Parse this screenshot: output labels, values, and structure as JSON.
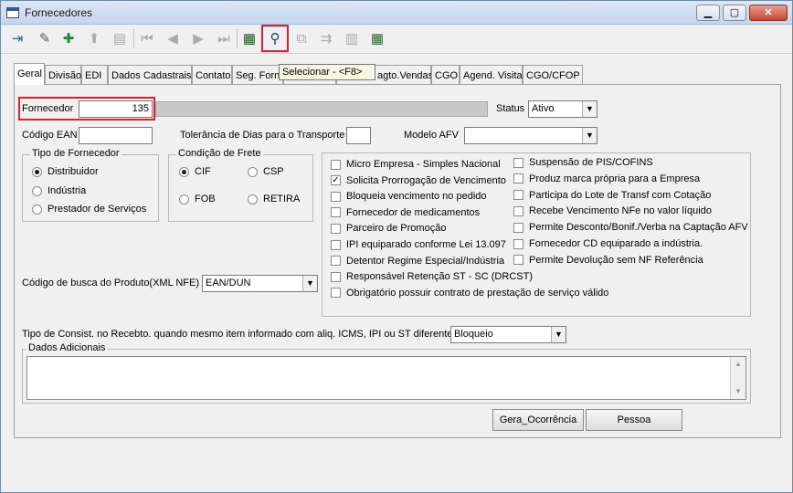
{
  "window": {
    "title": "Fornecedores"
  },
  "tooltip": "Selecionar - <F8>",
  "tabs": [
    "Geral",
    "Divisão",
    "EDI",
    "Dados Cadastrais",
    "Contato",
    "Seg. Forn",
    "",
    "agto.Vendas",
    "CGO",
    "Agend. Visita",
    "CGO/CFOP"
  ],
  "form": {
    "fornecedor_label": "Fornecedor",
    "fornecedor_value": "135",
    "status_label": "Status",
    "status_value": "Ativo",
    "codigo_ean_label": "Código EAN",
    "tolerancia_label": "Tolerância de Dias para o Transporte",
    "modelo_afv_label": "Modelo AFV",
    "tipo_fornecedor_label": "Tipo de Fornecedor",
    "tipo_options": [
      "Distribuidor",
      "Indústria",
      "Prestador de Serviços"
    ],
    "condicao_frete_label": "Condição de Frete",
    "frete_options": [
      "CIF",
      "CSP",
      "FOB",
      "RETIRA"
    ],
    "codigo_busca_label": "Código de busca do Produto(XML NFE) :",
    "codigo_busca_value": "EAN/DUN",
    "tipo_consist_label": "Tipo de Consist. no Recebto. quando mesmo item informado com aliq. ICMS, IPI ou ST diferentes:",
    "tipo_consist_value": "Bloqueio",
    "dados_adicionais_label": "Dados Adicionais"
  },
  "checks_left": [
    {
      "label": "Micro Empresa - Simples Nacional",
      "checked": false
    },
    {
      "label": "Solicita Prorrogação de Vencimento",
      "checked": true
    },
    {
      "label": "Bloqueia vencimento no pedido",
      "checked": false
    },
    {
      "label": "Fornecedor de medicamentos",
      "checked": false
    },
    {
      "label": "Parceiro de Promoção",
      "checked": false
    },
    {
      "label": "IPI equiparado conforme Lei 13.097",
      "checked": false
    },
    {
      "label": "Detentor Regime Especial/Indústria",
      "checked": false
    },
    {
      "label": "Responsável Retenção ST - SC (DRCST)",
      "checked": false
    },
    {
      "label": "Obrigatório possuir contrato de prestação de serviço válido",
      "checked": false
    }
  ],
  "checks_right": [
    {
      "label": "Suspensão de PIS/COFINS",
      "checked": false
    },
    {
      "label": "Produz marca própria para a Empresa",
      "checked": false
    },
    {
      "label": "Participa do Lote de Transf com Cotação",
      "checked": false
    },
    {
      "label": "Recebe Vencimento NFe no valor líquido",
      "checked": false
    },
    {
      "label": "Permite Desconto/Bonif./Verba na Captação AFV",
      "checked": false
    },
    {
      "label": "Fornecedor CD equiparado a indústria.",
      "checked": false
    },
    {
      "label": "Permite Devolução sem NF Referência",
      "checked": false
    }
  ],
  "buttons": {
    "gera_ocorrencia": "Gera_Ocorrência",
    "pessoa": "Pessoa"
  }
}
